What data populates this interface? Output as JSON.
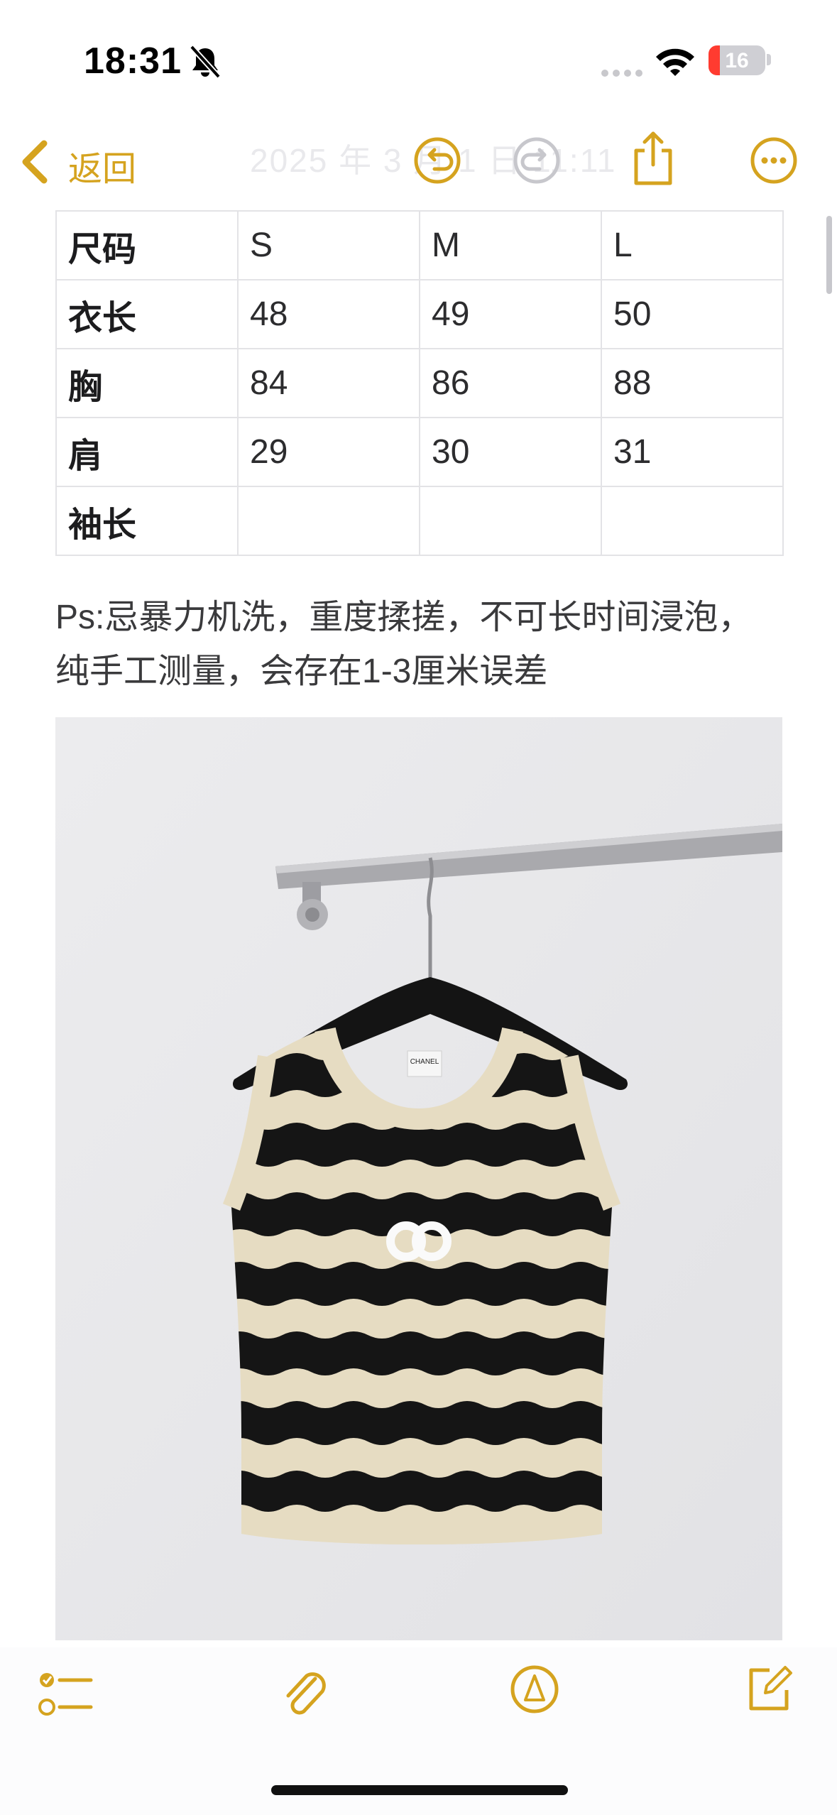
{
  "status_bar": {
    "time": "18:31",
    "battery_level": "16",
    "icons": [
      "bell-slash-icon",
      "cellular-signal-icon",
      "wifi-icon",
      "battery-charging-icon"
    ]
  },
  "nav": {
    "back_label": "返回",
    "faded_title": "2025 年 3 月 1 日 11:11",
    "icons": [
      "chevron-left-icon",
      "undo-icon",
      "redo-icon",
      "share-icon",
      "more-icon"
    ]
  },
  "size_table": {
    "rows": [
      [
        "尺码",
        "S",
        "M",
        "L"
      ],
      [
        "衣长",
        "48",
        "49",
        "50"
      ],
      [
        "胸",
        "84",
        "86",
        "88"
      ],
      [
        "肩",
        "29",
        "30",
        "31"
      ],
      [
        "袖长",
        "",
        "",
        ""
      ]
    ]
  },
  "note": {
    "line1": "Ps:忌暴力机洗，重度揉搓，不可长时间浸泡，",
    "line2": "纯手工测量，会存在1-3厘米误差"
  },
  "photo": {
    "subject": "striped sleeveless knit top on hanger",
    "label_text": "CHANEL",
    "colors": {
      "cream": "#e6dcc2",
      "black": "#151515",
      "wall": "#e9e9eb"
    }
  },
  "toolbar": {
    "icons": [
      "checklist-icon",
      "paperclip-icon",
      "markup-pen-icon",
      "compose-icon"
    ]
  },
  "accent_color": "#d5a31f"
}
